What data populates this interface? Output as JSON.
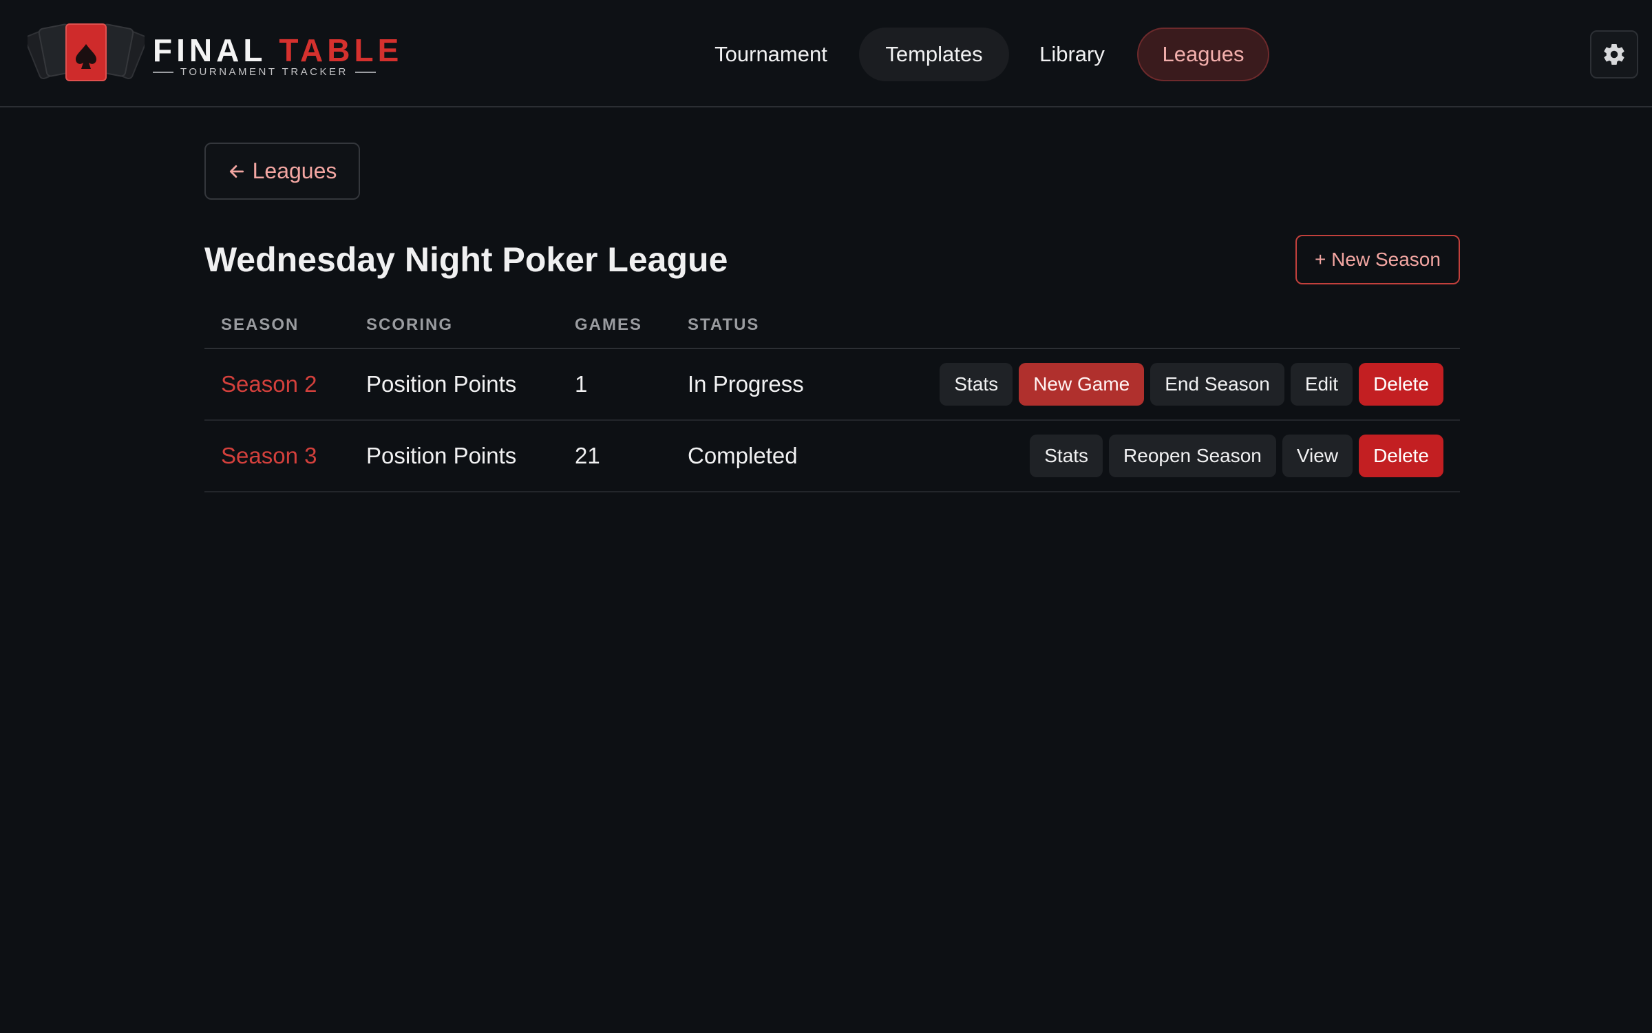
{
  "app": {
    "brand_word1": "FINAL",
    "brand_word2": "TABLE",
    "brand_subtitle": "TOURNAMENT TRACKER",
    "logo_icon": "spade-cards-icon"
  },
  "nav": {
    "items": [
      {
        "label": "Tournament",
        "state": "default"
      },
      {
        "label": "Templates",
        "state": "hover"
      },
      {
        "label": "Library",
        "state": "default"
      },
      {
        "label": "Leagues",
        "state": "active"
      }
    ],
    "settings_icon": "gear-icon"
  },
  "page": {
    "back_label": "Leagues",
    "back_icon": "arrow-left-icon",
    "title": "Wednesday Night Poker League",
    "new_season_label": "+ New Season"
  },
  "table": {
    "columns": [
      "SEASON",
      "SCORING",
      "GAMES",
      "STATUS"
    ],
    "rows": [
      {
        "season": "Season 2",
        "scoring": "Position Points",
        "games": "1",
        "status": "In Progress",
        "actions": [
          "Stats",
          "New Game",
          "End Season",
          "Edit",
          "Delete"
        ]
      },
      {
        "season": "Season 3",
        "scoring": "Position Points",
        "games": "21",
        "status": "Completed",
        "actions": [
          "Stats",
          "Reopen Season",
          "View",
          "Delete"
        ]
      }
    ]
  },
  "colors": {
    "background": "#0d1014",
    "accent": "#d3403c",
    "danger": "#c31f22",
    "active_nav_bg": "#3a1b1d"
  }
}
